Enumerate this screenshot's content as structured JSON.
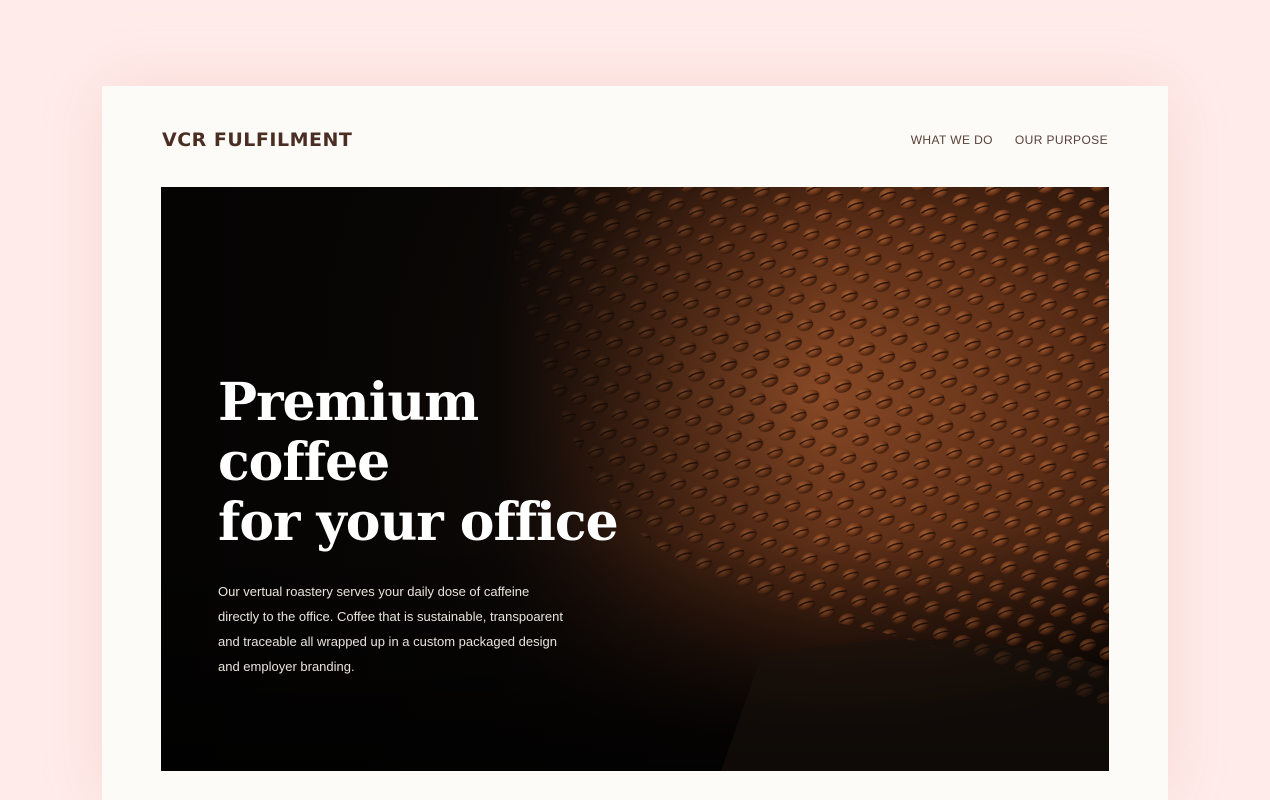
{
  "header": {
    "logo": "VCR FULFILMENT",
    "nav": [
      {
        "label": "WHAT WE DO"
      },
      {
        "label": "OUR PURPOSE"
      }
    ]
  },
  "hero": {
    "headline_line1": "Premium coffee",
    "headline_line2": "for your office",
    "body": "Our vertual roastery serves your daily dose of caffeine directly to the office. Coffee that is sustainable, transpoarent and traceable all wrapped up in a custom packaged design and employer branding.",
    "image": "coffee-beans-photo"
  },
  "colors": {
    "background": "#ffecea",
    "card": "#fdfbf7",
    "logo": "#4a2e24",
    "hero_text": "#ffffff"
  }
}
